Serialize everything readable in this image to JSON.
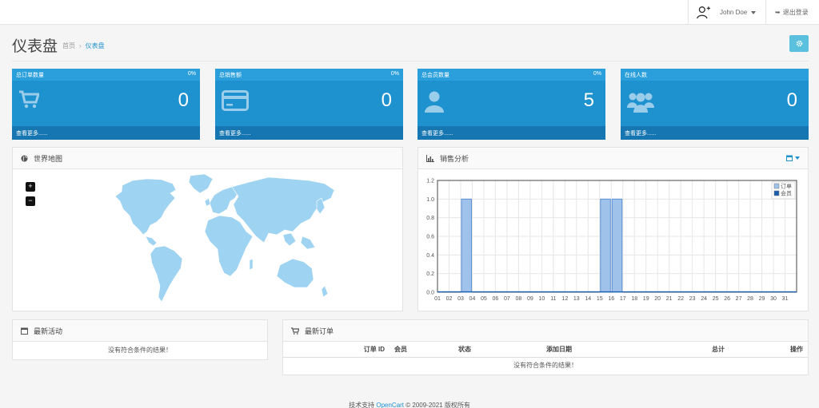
{
  "topbar": {
    "user_name": "John Doe",
    "logout_label": "退出登录"
  },
  "header": {
    "title": "仪表盘",
    "breadcrumb": [
      "首页",
      "仪表盘"
    ]
  },
  "tiles": [
    {
      "label": "总订单数量",
      "percent": "0%",
      "value": "0",
      "link": "查看更多......",
      "icon": "cart-icon"
    },
    {
      "label": "总销售额",
      "percent": "0%",
      "value": "0",
      "link": "查看更多......",
      "icon": "credit-card-icon"
    },
    {
      "label": "总会员数量",
      "percent": "0%",
      "value": "5",
      "link": "查看更多......",
      "icon": "user-icon"
    },
    {
      "label": "在线人数",
      "percent": "",
      "value": "0",
      "link": "查看更多......",
      "icon": "users-icon"
    }
  ],
  "world_map": {
    "title": "世界地图",
    "zoom_in": "+",
    "zoom_out": "−"
  },
  "sales": {
    "title": "销售分析",
    "colors": {
      "orders": "#9ec2ea",
      "customers": "#1c5fb0"
    }
  },
  "chart_data": {
    "type": "bar",
    "categories": [
      "01",
      "02",
      "03",
      "04",
      "05",
      "06",
      "07",
      "08",
      "09",
      "10",
      "11",
      "12",
      "13",
      "14",
      "15",
      "16",
      "17",
      "18",
      "19",
      "20",
      "21",
      "22",
      "23",
      "24",
      "25",
      "26",
      "27",
      "28",
      "29",
      "30",
      "31"
    ],
    "series": [
      {
        "name": "订单",
        "values": [
          0,
          0,
          1,
          0,
          0,
          0,
          0,
          0,
          0,
          0,
          0,
          0,
          0,
          0,
          1,
          1,
          0,
          0,
          0,
          0,
          0,
          0,
          0,
          0,
          0,
          0,
          0,
          0,
          0,
          0,
          0
        ]
      },
      {
        "name": "会员",
        "values": [
          0,
          0,
          0,
          0,
          0,
          0,
          0,
          0,
          0,
          0,
          0,
          0,
          0,
          0,
          0,
          0,
          0,
          0,
          0,
          0,
          0,
          0,
          0,
          0,
          0,
          0,
          0,
          0,
          0,
          0,
          0
        ]
      }
    ],
    "yticks": [
      "0.0",
      "0.2",
      "0.4",
      "0.6",
      "0.8",
      "1.0",
      "1.2"
    ],
    "ylim": [
      0,
      1.2
    ],
    "grid": true,
    "legend": "top-right"
  },
  "activity": {
    "title": "最新活动",
    "empty": "没有符合条件的结果！"
  },
  "orders": {
    "title": "最新订单",
    "columns": [
      "订单 ID",
      "会员",
      "状态",
      "添加日期",
      "总计",
      "操作"
    ],
    "empty": "没有符合条件的结果！"
  },
  "footer": {
    "prefix": "技术支持",
    "link": "OpenCart",
    "suffix": "© 2009-2021 版权所有"
  }
}
